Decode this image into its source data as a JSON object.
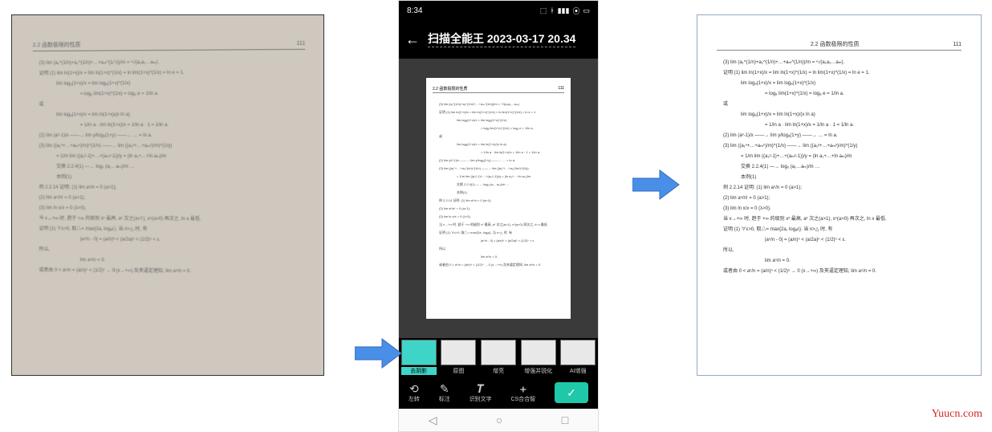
{
  "page": {
    "section": "2.2 函数极限的性质",
    "pageno": "111",
    "lines": [
      "(3) lim (a₁^(1/n)+a₂^(1/n)+…+aₘ^(1/n))/m = ⁿ√(a₁a₂…aₘ).",
      "证明 (1) lim ln(1+x)/x = lim ln(1+x)^(1/x) = ln lim(1+x)^(1/x) = ln e = 1.",
      "lim logₐ(1+x)/x = lim logₐ(1+x)^(1/x)",
      "= logₐ lim(1+x)^(1/x) = logₐ e = 1/ln a.",
      "或",
      "lim logₐ(1+x)/x = lim ln(1+x)/(x ln a)",
      "= 1/ln a · lim ln(1+x)/x = 1/ln a · 1 = 1/ln a.",
      "(2) lim (aˣ-1)/x ――→ lim y/logₐ(1+y) ――→ … = ln a.",
      "(3) lim ((a₁ⁿ+…+aₘⁿ)/m)^(1/n) ――→ lim ((a₁ʸ+…+aₘʸ)/m)^(1/y)",
      "= 1/m lim ((a₁ʸ-1)+…+(aₘʸ-1))/y = (ln a₁+…+ln aₘ)/m",
      "交换 2.2.4(1) —→ logₑ (a₁…aₘ)/m …",
      "本例(1)",
      "例 2.2.14  证明: (1) lim aⁿ/n = 0 (a>1);",
      "(2) lim aⁿ/n! = 0 (a>1);",
      "(3) lim ln x/x = 0 (λ>0).",
      "当 x→+∞ 时, 趋于 +∞ 的级别 xˣ 最高, aˣ 次之(a>1), xⁿ(a>0) 再次之, ln x 最低.",
      "证明 (1) ∀ε>0, 取△= max{2a, logₐε}. 当 n>△ 时, 有",
      "|aⁿ/n - 0| = (a/n)ⁿ < (a/2a)ⁿ < (1/2)ⁿ < ε.",
      "所以,",
      "lim aⁿ/n = 0.",
      "或者由 0 < aⁿ/n = (a/n)ⁿ < (1/2)ⁿ → 0 (x→+∞) 及夹逼定理知, lim aⁿ/n = 0."
    ]
  },
  "phone": {
    "time": "8:34",
    "title": "扫描全能王 2023-03-17 20.34",
    "filters": [
      "去阴影",
      "原图",
      "增亮",
      "增强并锐化",
      "AI增强"
    ],
    "tools": {
      "rotate": "左转",
      "annotate": "标注",
      "ocr": "识别文字",
      "merge": "CS合合智"
    }
  },
  "watermark": "Yuucn.com"
}
